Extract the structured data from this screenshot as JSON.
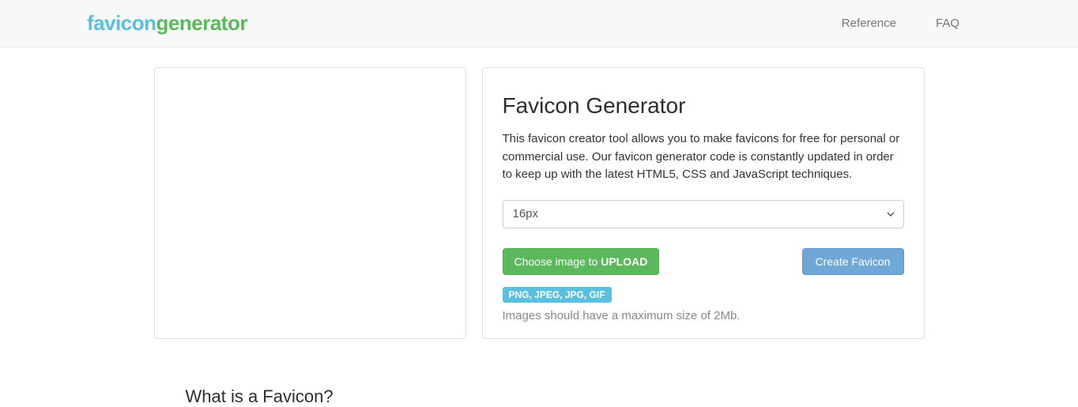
{
  "logo": {
    "part1": "favicon",
    "part2": "generator"
  },
  "nav": {
    "reference": "Reference",
    "faq": "FAQ"
  },
  "main": {
    "title": "Favicon Generator",
    "description": "This favicon creator tool allows you to make favicons for free for personal or commercial use. Our favicon generator code is constantly updated in order to keep up with the latest HTML5, CSS and JavaScript techniques.",
    "size_selected": "16px",
    "upload_prefix": "Choose image to ",
    "upload_bold": "UPLOAD",
    "create_label": "Create Favicon",
    "formats_badge": "PNG, JPEG, JPG, GIF",
    "hint": "Images should have a maximum size of 2Mb."
  },
  "section": {
    "heading": "What is a Favicon?"
  }
}
